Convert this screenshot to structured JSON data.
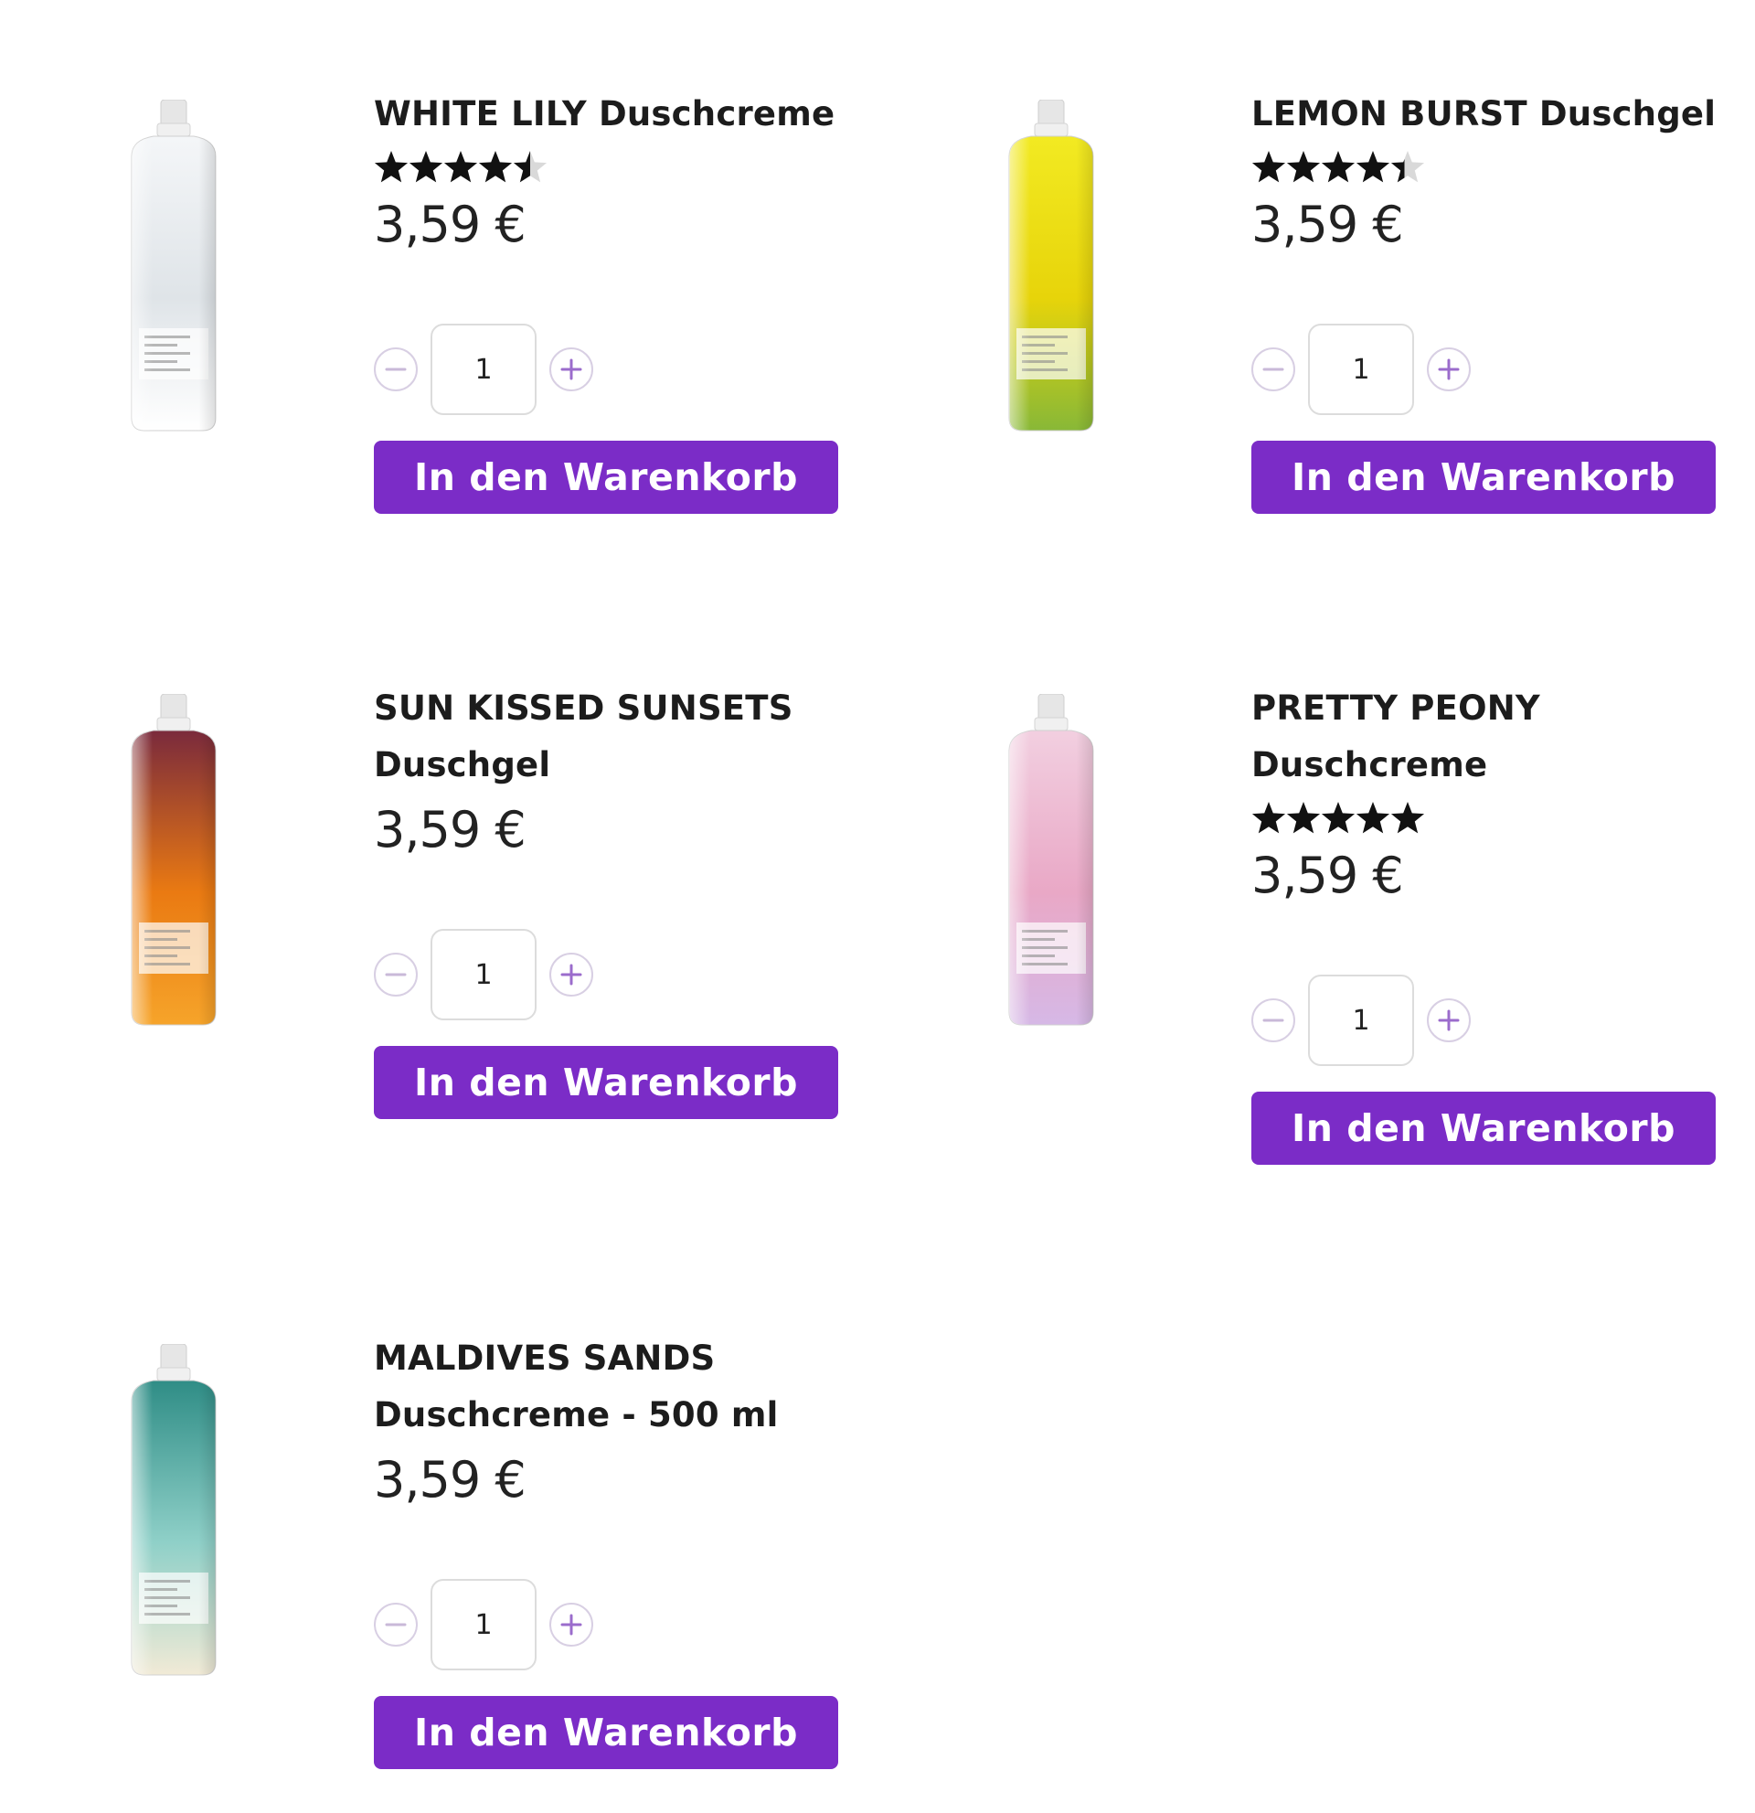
{
  "accent_color": "#7b2cc7",
  "products": [
    {
      "name": "WHITE LILY Duschcreme",
      "rating": 4.5,
      "price": "3,59 €",
      "quantity": "1",
      "cart_label": "In den Warenkorb",
      "bottle_colors": [
        "#f4f6f8",
        "#dfe4e8",
        "#ffffff"
      ]
    },
    {
      "name": "LEMON BURST Duschgel",
      "rating": 4.4,
      "price": "3,59 €",
      "quantity": "1",
      "cart_label": "In den Warenkorb",
      "bottle_colors": [
        "#f2ea22",
        "#e7d40a",
        "#88b837"
      ]
    },
    {
      "name": "SUN KISSED SUNSETS Duschgel",
      "price": "3,59 €",
      "quantity": "1",
      "cart_label": "In den Warenkorb",
      "bottle_colors": [
        "#7a2a3c",
        "#ea7a12",
        "#f6a42a"
      ]
    },
    {
      "name": "PRETTY PEONY Duschcreme",
      "rating": 5,
      "price": "3,59 €",
      "quantity": "1",
      "cart_label": "In den Warenkorb",
      "bottle_colors": [
        "#f2cfe0",
        "#e9a8c6",
        "#d6b8e6"
      ]
    },
    {
      "name": "MALDIVES SANDS Duschcreme - 500 ml",
      "price": "3,59 €",
      "quantity": "1",
      "cart_label": "In den Warenkorb",
      "bottle_colors": [
        "#2f8d86",
        "#8fd0c8",
        "#f1ead6"
      ]
    }
  ]
}
